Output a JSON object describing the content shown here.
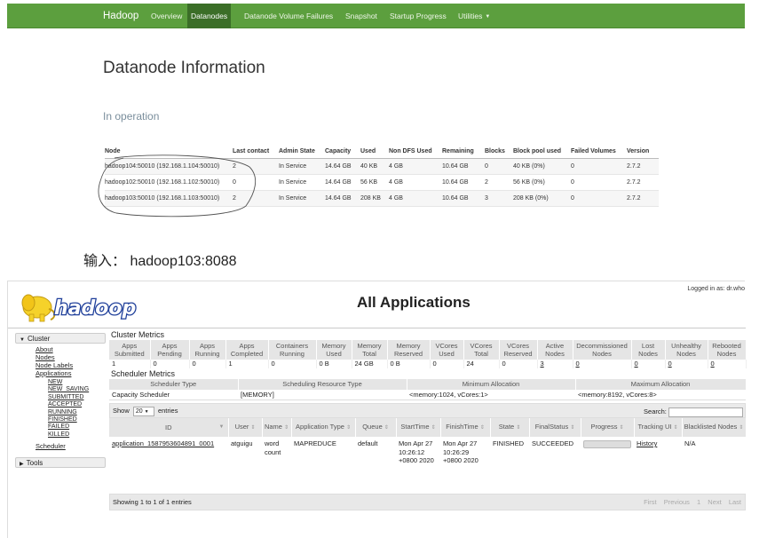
{
  "hdfs": {
    "nav": {
      "brand": "Hadoop",
      "items": [
        "Overview",
        "Datanodes",
        "Datanode Volume Failures",
        "Snapshot",
        "Startup Progress",
        "Utilities"
      ]
    },
    "title": "Datanode Information",
    "subtitle": "In operation",
    "table": {
      "headers": [
        "Node",
        "Last contact",
        "Admin State",
        "Capacity",
        "Used",
        "Non DFS Used",
        "Remaining",
        "Blocks",
        "Block pool used",
        "Failed Volumes",
        "Version"
      ],
      "rows": [
        [
          "hadoop104:50010 (192.168.1.104:50010)",
          "2",
          "In Service",
          "14.64 GB",
          "40 KB",
          "4 GB",
          "10.64 GB",
          "0",
          "40 KB (0%)",
          "0",
          "2.7.2"
        ],
        [
          "hadoop102:50010 (192.168.1.102:50010)",
          "0",
          "In Service",
          "14.64 GB",
          "56 KB",
          "4 GB",
          "10.64 GB",
          "2",
          "56 KB (0%)",
          "0",
          "2.7.2"
        ],
        [
          "hadoop103:50010 (192.168.1.103:50010)",
          "2",
          "In Service",
          "14.64 GB",
          "208 KB",
          "4 GB",
          "10.64 GB",
          "3",
          "208 KB (0%)",
          "0",
          "2.7.2"
        ]
      ]
    }
  },
  "caption": "输入： hadoop103:8088",
  "yarn": {
    "logo_text": "hadoop",
    "title": "All Applications",
    "logged_in": "Logged in as: dr.who",
    "sidebar": {
      "cluster": "Cluster",
      "cluster_links": [
        "About",
        "Nodes",
        "Node Labels",
        "Applications"
      ],
      "app_states": [
        "NEW",
        "NEW_SAVING",
        "SUBMITTED",
        "ACCEPTED",
        "RUNNING",
        "FINISHED",
        "FAILED",
        "KILLED"
      ],
      "scheduler": "Scheduler",
      "tools": "Tools"
    },
    "cluster_metrics": {
      "heading": "Cluster Metrics",
      "headers": [
        "Apps Submitted",
        "Apps Pending",
        "Apps Running",
        "Apps Completed",
        "Containers Running",
        "Memory Used",
        "Memory Total",
        "Memory Reserved",
        "VCores Used",
        "VCores Total",
        "VCores Reserved",
        "Active Nodes",
        "Decommissioned Nodes",
        "Lost Nodes",
        "Unhealthy Nodes",
        "Rebooted Nodes"
      ],
      "values": [
        "1",
        "0",
        "0",
        "1",
        "0",
        "0 B",
        "24 GB",
        "0 B",
        "0",
        "24",
        "0",
        "3",
        "0",
        "0",
        "0",
        "0"
      ]
    },
    "scheduler_metrics": {
      "heading": "Scheduler Metrics",
      "headers": [
        "Scheduler Type",
        "Scheduling Resource Type",
        "Minimum Allocation",
        "Maximum Allocation"
      ],
      "values": [
        "Capacity Scheduler",
        "[MEMORY]",
        "<memory:1024, vCores:1>",
        "<memory:8192, vCores:8>"
      ]
    },
    "table_controls": {
      "show": "Show",
      "entries_count": "20",
      "entries": "entries",
      "search": "Search:"
    },
    "apps": {
      "headers": [
        "ID",
        "User",
        "Name",
        "Application Type",
        "Queue",
        "StartTime",
        "FinishTime",
        "State",
        "FinalStatus",
        "Progress",
        "Tracking UI",
        "Blacklisted Nodes"
      ],
      "rows": [
        {
          "id": "application_1587953604891_0001",
          "user": "atguigu",
          "name": "word count",
          "type": "MAPREDUCE",
          "queue": "default",
          "start": "Mon Apr 27 10:26:12 +0800 2020",
          "finish": "Mon Apr 27 10:26:29 +0800 2020",
          "state": "FINISHED",
          "final_status": "SUCCEEDED",
          "progress": 1.0,
          "tracking": "History",
          "blacklisted": "N/A"
        }
      ]
    },
    "footer": {
      "info": "Showing 1 to 1 of 1 entries",
      "pager": [
        "First",
        "Previous",
        "1",
        "Next",
        "Last"
      ]
    }
  }
}
